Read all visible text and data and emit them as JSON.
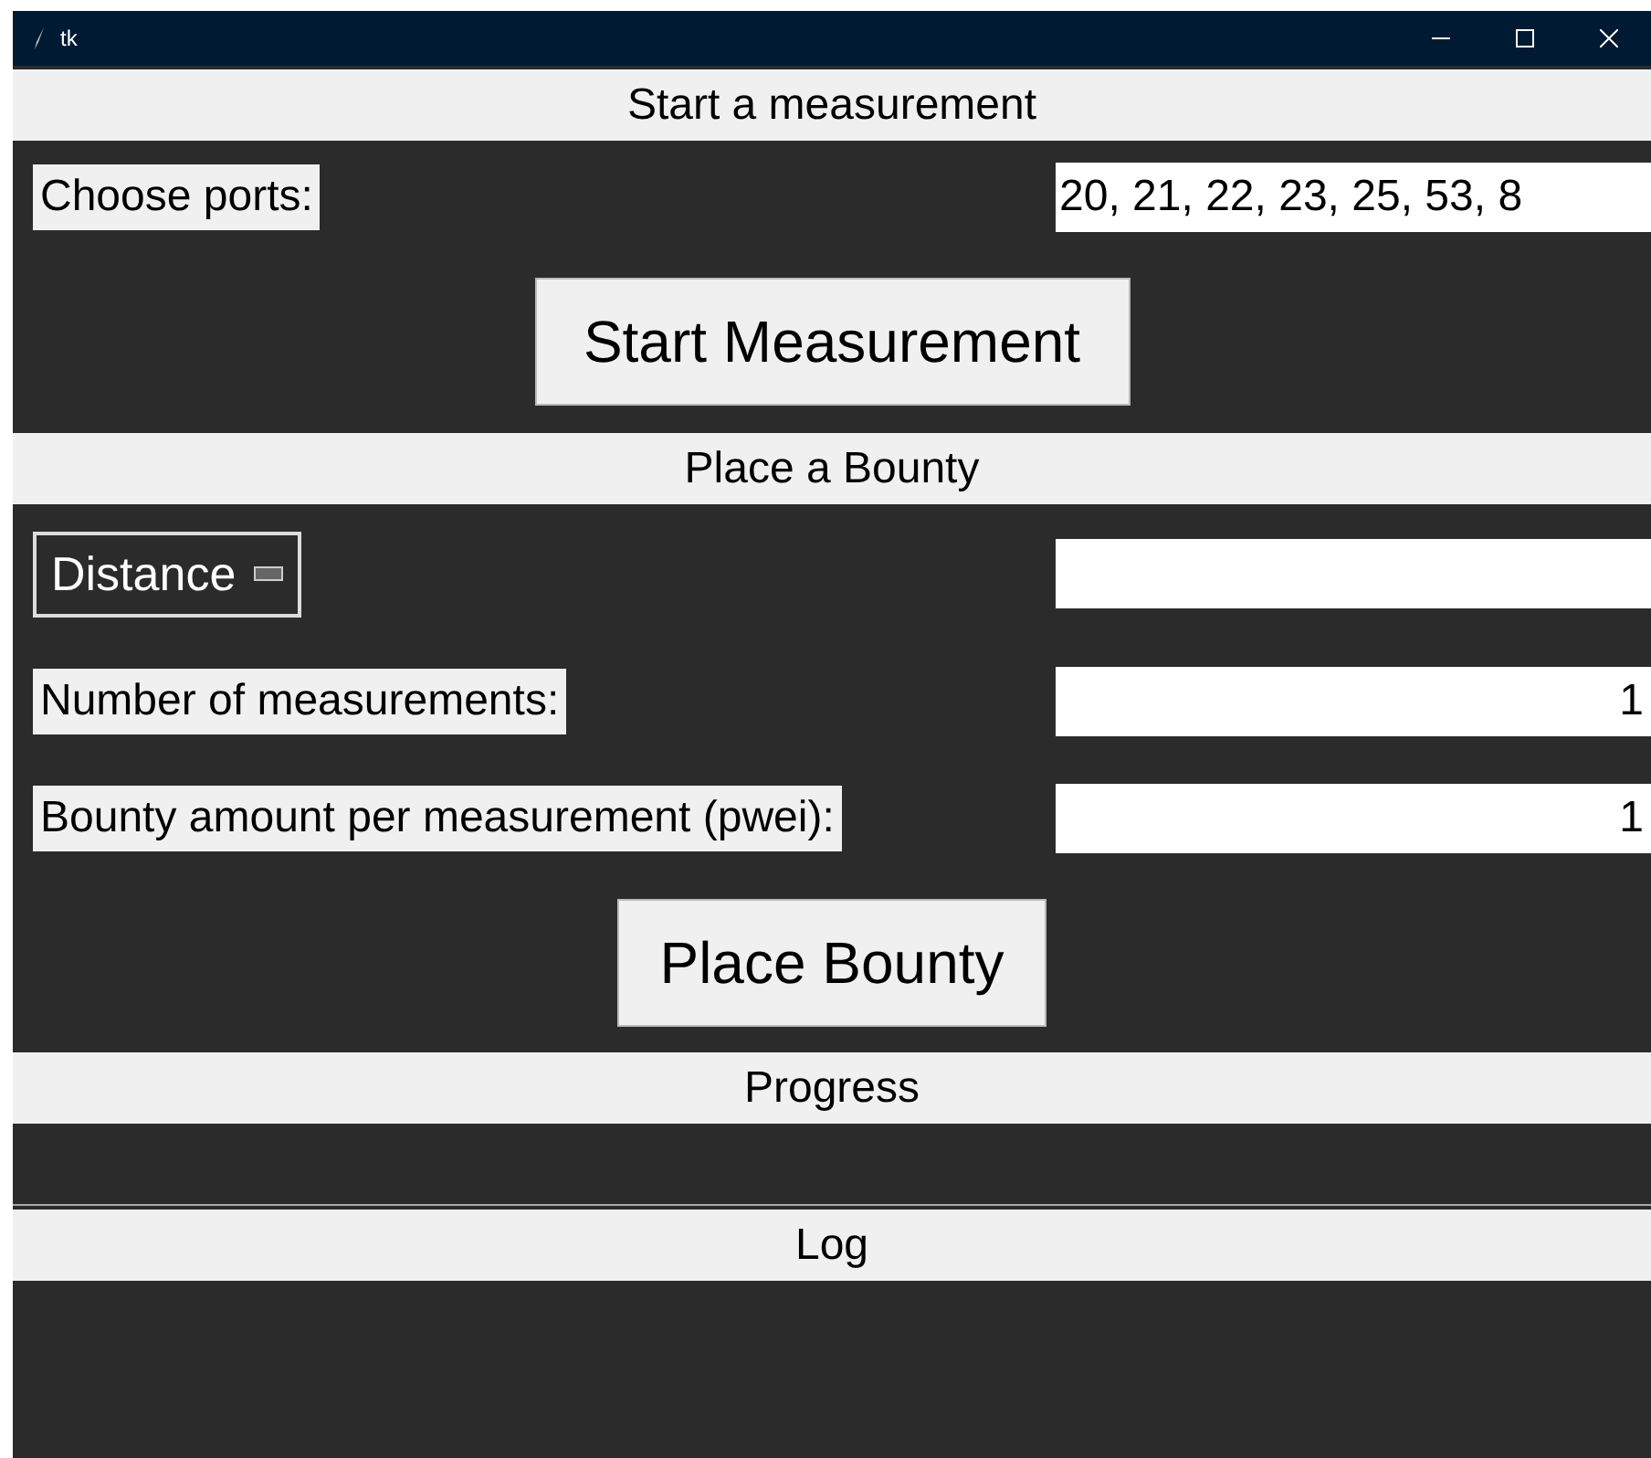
{
  "window": {
    "title": "tk"
  },
  "measurement": {
    "title": "Start a measurement",
    "ports_label": "Choose ports:",
    "ports_value": "20, 21, 22, 23, 25, 53, 8",
    "button": "Start Measurement"
  },
  "bounty": {
    "title": "Place a Bounty",
    "rows": [
      {
        "kind": "dropdown",
        "label": "Distance",
        "value": ""
      },
      {
        "kind": "label",
        "label": "Number of measurements:",
        "value": "1"
      },
      {
        "kind": "label",
        "label": "Bounty amount per measurement (pwei):",
        "value": "1"
      }
    ],
    "button": "Place Bounty"
  },
  "progress": {
    "title": "Progress"
  },
  "log": {
    "title": "Log"
  }
}
